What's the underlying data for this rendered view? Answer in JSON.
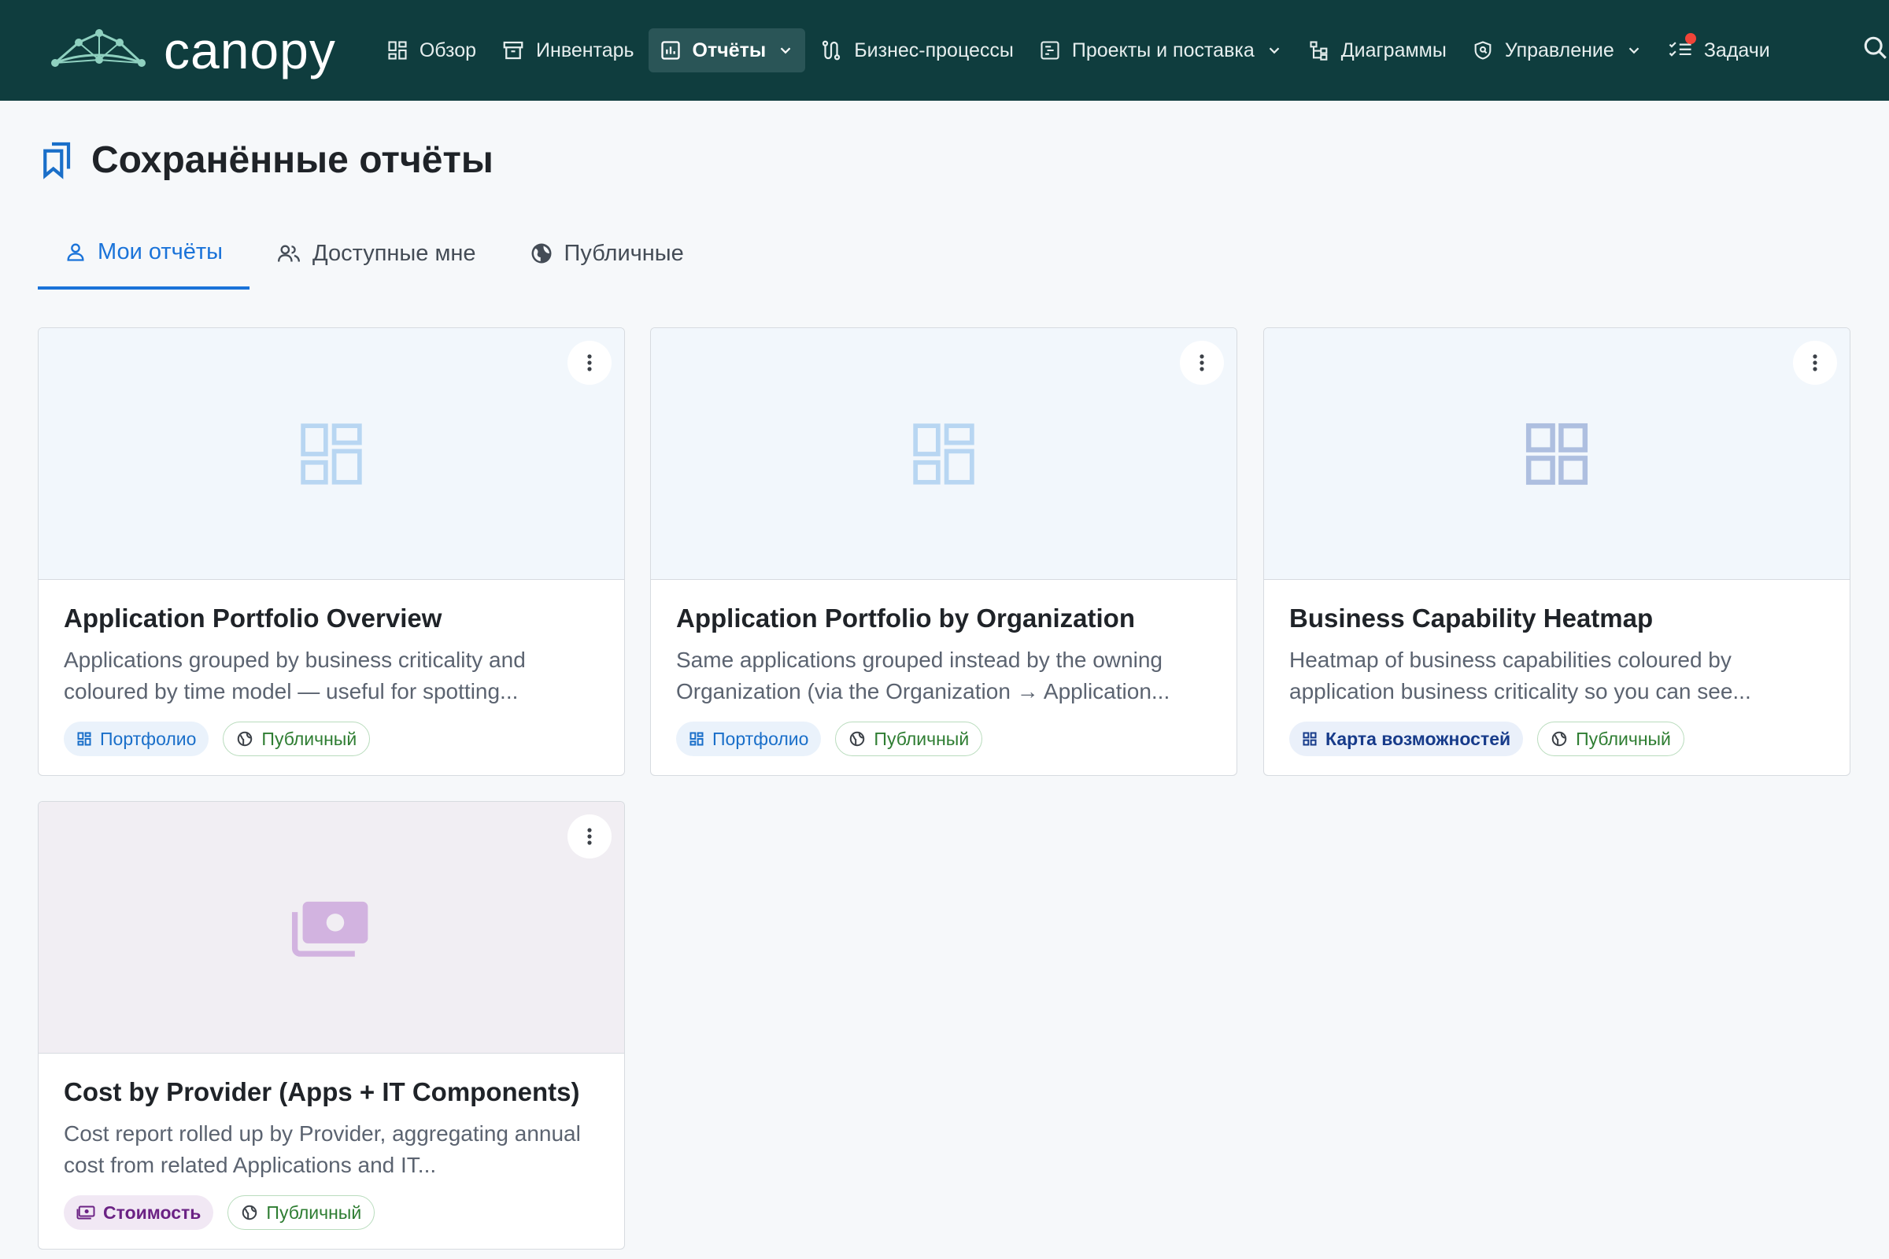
{
  "app": {
    "name": "canopy"
  },
  "nav": {
    "items": [
      {
        "label": "Обзор"
      },
      {
        "label": "Инвентарь"
      },
      {
        "label": "Отчёты"
      },
      {
        "label": "Бизнес-процессы"
      },
      {
        "label": "Проекты и поставка"
      },
      {
        "label": "Диаграммы"
      },
      {
        "label": "Управление"
      },
      {
        "label": "Задачи"
      }
    ]
  },
  "page": {
    "title": "Сохранённые отчёты"
  },
  "tabs": [
    {
      "label": "Мои отчёты",
      "active": true
    },
    {
      "label": "Доступные мне",
      "active": false
    },
    {
      "label": "Публичные",
      "active": false
    }
  ],
  "cards": [
    {
      "title": "Application Portfolio Overview",
      "description": "Applications grouped by business criticality and coloured by time model — useful for spotting...",
      "type_label": "Портфолио",
      "visibility_label": "Публичный"
    },
    {
      "title": "Application Portfolio by Organization",
      "description": "Same applications grouped instead by the owning Organization (via the Organization → Application...",
      "type_label": "Портфолио",
      "visibility_label": "Публичный"
    },
    {
      "title": "Business Capability Heatmap",
      "description": "Heatmap of business capabilities coloured by application business criticality so you can see...",
      "type_label": "Карта возможностей",
      "visibility_label": "Публичный"
    },
    {
      "title": "Cost by Provider (Apps + IT Components)",
      "description": "Cost report rolled up by Provider, aggregating annual cost from related Applications and IT...",
      "type_label": "Стоимость",
      "visibility_label": "Публичный"
    }
  ],
  "colors": {
    "topbar": "#0f3d3e",
    "accent": "#1a73d9",
    "public_green": "#2e7d32",
    "notification": "#f04438"
  }
}
